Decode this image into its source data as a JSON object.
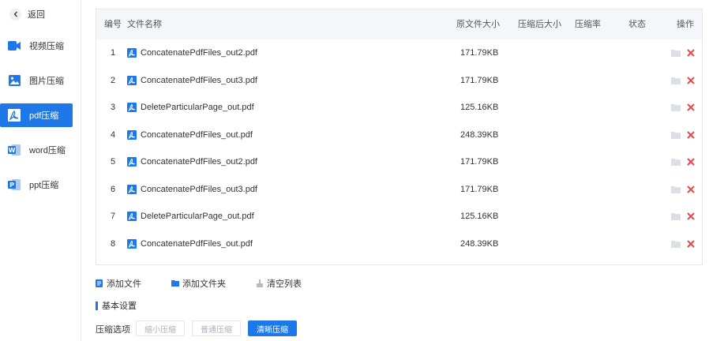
{
  "sidebar": {
    "back_label": "返回",
    "items": [
      {
        "label": "视频压缩",
        "icon": "video-icon"
      },
      {
        "label": "图片压缩",
        "icon": "image-icon"
      },
      {
        "label": "pdf压缩",
        "icon": "pdf-icon",
        "active": true
      },
      {
        "label": "word压缩",
        "icon": "word-icon"
      },
      {
        "label": "ppt压缩",
        "icon": "ppt-icon"
      }
    ]
  },
  "table": {
    "headers": {
      "num": "编号",
      "name": "文件名称",
      "orig_size": "原文件大小",
      "comp_size": "压缩后大小",
      "ratio": "压缩率",
      "status": "状态",
      "actions": "操作"
    },
    "rows": [
      {
        "num": "1",
        "name": "ConcatenatePdfFiles_out2.pdf",
        "size": "171.79KB"
      },
      {
        "num": "2",
        "name": "ConcatenatePdfFiles_out3.pdf",
        "size": "171.79KB"
      },
      {
        "num": "3",
        "name": "DeleteParticularPage_out.pdf",
        "size": "125.16KB"
      },
      {
        "num": "4",
        "name": "ConcatenatePdfFiles_out.pdf",
        "size": "248.39KB"
      },
      {
        "num": "5",
        "name": "ConcatenatePdfFiles_out2.pdf",
        "size": "171.79KB"
      },
      {
        "num": "6",
        "name": "ConcatenatePdfFiles_out3.pdf",
        "size": "171.79KB"
      },
      {
        "num": "7",
        "name": "DeleteParticularPage_out.pdf",
        "size": "125.16KB"
      },
      {
        "num": "8",
        "name": "ConcatenatePdfFiles_out.pdf",
        "size": "248.39KB"
      }
    ]
  },
  "toolbar": {
    "add_file": "添加文件",
    "add_folder": "添加文件夹",
    "clear_list": "清空列表"
  },
  "settings": {
    "title": "基本设置",
    "option_label": "压缩选项",
    "options": [
      "缩小压缩",
      "普通压缩",
      "清晰压缩"
    ],
    "selected": "清晰压缩"
  },
  "colors": {
    "accent": "#1f78e8",
    "delete": "#e8484a",
    "header_bg": "#f4f6f9"
  }
}
